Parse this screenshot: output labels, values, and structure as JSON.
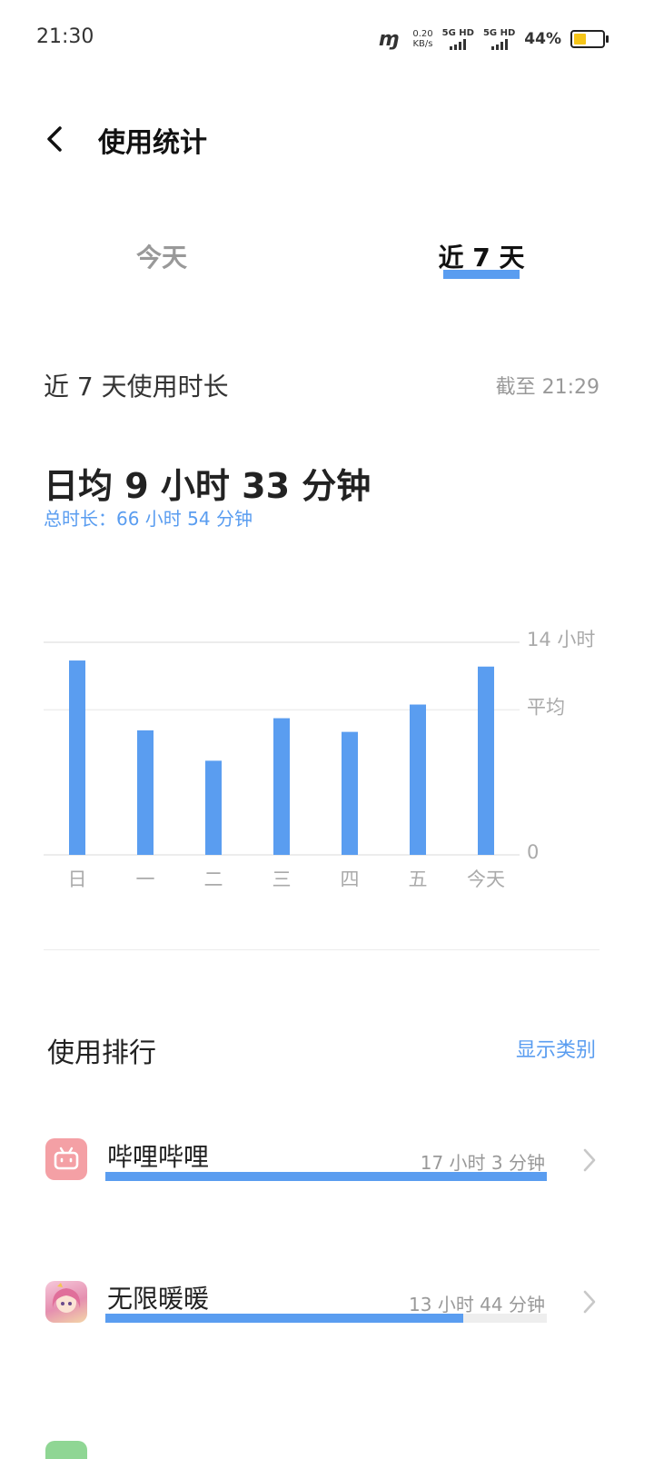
{
  "status_bar": {
    "time": "21:30",
    "carrier_mark": "ɱ",
    "speed_value": "0.20",
    "speed_unit": "KB/s",
    "sim1": "5G HD",
    "sim2": "5G HD",
    "battery_text": "44%",
    "battery_level": 0.44
  },
  "header": {
    "back_icon": "chevron-left-icon",
    "title": "使用统计"
  },
  "tabs": [
    {
      "label": "今天",
      "active": false
    },
    {
      "label": "近 7 天",
      "active": true
    }
  ],
  "period": {
    "label": "近 7 天使用时长",
    "cutoff": "截至 21:29"
  },
  "summary": {
    "daily_average": "日均 9 小时 33 分钟",
    "total": "总时长：66 小时 54 分钟"
  },
  "chart_data": {
    "type": "bar",
    "categories": [
      "日",
      "一",
      "二",
      "三",
      "四",
      "五",
      "今天"
    ],
    "values": [
      12.8,
      8.2,
      6.2,
      9.0,
      8.1,
      9.9,
      12.4
    ],
    "y_labels": {
      "max": "14 小时",
      "average": "平均",
      "min": "0"
    },
    "ylim": [
      0,
      14
    ],
    "average": 9.55,
    "color": "#5a9df0"
  },
  "ranking": {
    "title": "使用排行",
    "show_category": "显示类别",
    "items": [
      {
        "name": "哔哩哔哩",
        "duration": "17 小时 3 分钟",
        "ratio": 1.0,
        "icon": "bilibili-tv-icon"
      },
      {
        "name": "无限暖暖",
        "duration": "13 小时 44 分钟",
        "ratio": 0.81,
        "icon": "game-avatar-icon"
      }
    ]
  }
}
